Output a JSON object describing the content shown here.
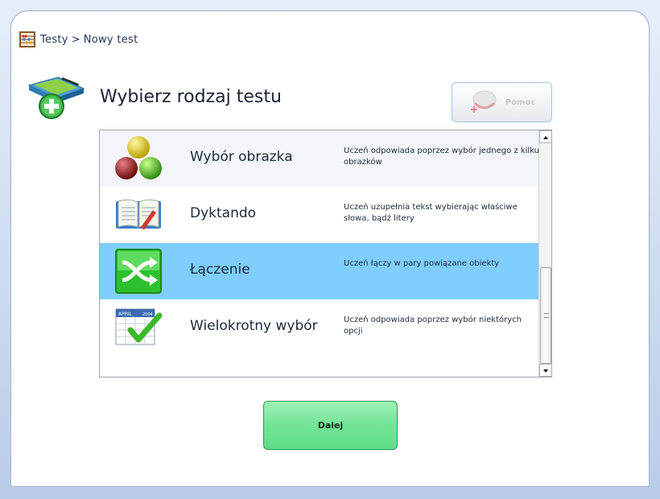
{
  "breadcrumb": {
    "root": "Testy",
    "separator": ">",
    "current": "Nowy test"
  },
  "heading": {
    "title": "Wybierz rodzaj testu",
    "icon": "add-book-icon"
  },
  "help_button": {
    "label": "Pomoc",
    "icon": "lifebuoy-icon"
  },
  "test_types": [
    {
      "name": "Wybór obrazka",
      "description": "Uczeń odpowiada poprzez wybór jednego z kilku obrazków",
      "icon": "colored-balls-icon",
      "selected": false
    },
    {
      "name": "Dyktando",
      "description": "Uczeń uzupełnia tekst wybierając właściwe słowa, bądź litery",
      "icon": "open-book-pencil-icon",
      "selected": false
    },
    {
      "name": "Łączenie",
      "description": "Uczeń łączy w pary powiązane obiekty",
      "icon": "shuffle-arrows-icon",
      "selected": true
    },
    {
      "name": "Wielokrotny wybór",
      "description": "Uczeń odpowiada poprzez wybór niektórych opcji",
      "icon": "calendar-check-icon",
      "selected": false
    }
  ],
  "calendar_icon_text": {
    "month": "APRIL",
    "year": "2004"
  },
  "next_button": {
    "label": "Dalej"
  },
  "colors": {
    "selected_row": "#7fcefd",
    "next_button": "#72e496",
    "frame": "#b9cce8"
  }
}
